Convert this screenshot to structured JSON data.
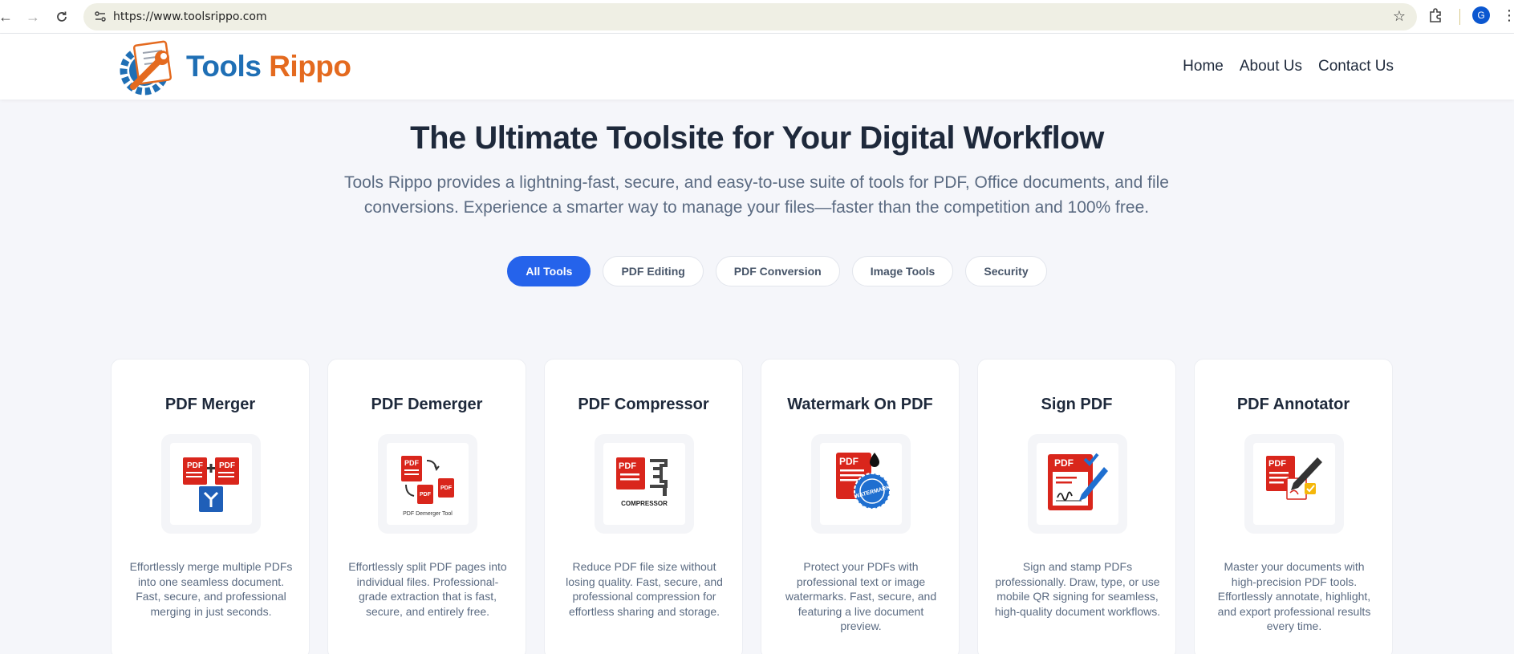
{
  "browser": {
    "url": "https://www.toolsrippo.com",
    "profile_initial": "G"
  },
  "header": {
    "brand_part1": "Tools",
    "brand_part2": "Rippo",
    "nav": [
      "Home",
      "About Us",
      "Contact Us"
    ]
  },
  "hero": {
    "title": "The Ultimate Toolsite for Your Digital Workflow",
    "subtitle": "Tools Rippo provides a lightning-fast, secure, and easy-to-use suite of tools for PDF, Office documents, and file conversions. Experience a smarter way to manage your files—faster than the competition and 100% free."
  },
  "filters": {
    "items": [
      "All Tools",
      "PDF Editing",
      "PDF Conversion",
      "Image Tools",
      "Security"
    ],
    "active": "All Tools",
    "active_color": "#2563eb"
  },
  "tools": [
    {
      "title": "PDF Merger",
      "icon": "pdf-merge-icon",
      "desc": "Effortlessly merge multiple PDFs into one seamless document. Fast, secure, and professional merging in just seconds."
    },
    {
      "title": "PDF Demerger",
      "icon": "pdf-split-icon",
      "icon_caption": "PDF Demerger Tool",
      "desc": "Effortlessly split PDF pages into individual files. Professional-grade extraction that is fast, secure, and entirely free."
    },
    {
      "title": "PDF Compressor",
      "icon": "pdf-compress-icon",
      "icon_caption": "COMPRESSOR",
      "desc": "Reduce PDF file size without losing quality. Fast, secure, and professional compression for effortless sharing and storage."
    },
    {
      "title": "Watermark On PDF",
      "icon": "pdf-watermark-icon",
      "icon_caption": "WATERMARK",
      "desc": "Protect your PDFs with professional text or image watermarks. Fast, secure, and featuring a live document preview."
    },
    {
      "title": "Sign PDF",
      "icon": "pdf-sign-icon",
      "desc": "Sign and stamp PDFs professionally. Draw, type, or use mobile QR signing for seamless, high-quality document workflows."
    },
    {
      "title": "PDF Annotator",
      "icon": "pdf-annotate-icon",
      "desc": "Master your documents with high-precision PDF tools. Effortlessly annotate, highlight, and export professional results every time."
    }
  ],
  "icon_label": "PDF",
  "colors": {
    "pdf_red": "#d9261c",
    "brand_blue": "#1f6fb5",
    "brand_orange": "#e46a1f"
  }
}
